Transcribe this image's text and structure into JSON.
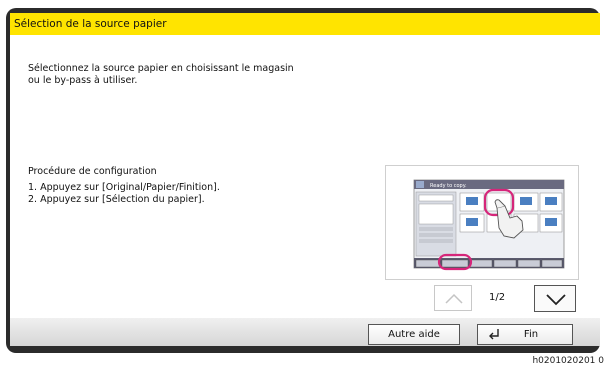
{
  "dialog": {
    "title": "Sélection de la source papier",
    "intro": "Sélectionnez la source papier en choisissant le magasin ou le by-pass à utiliser.",
    "procedure_title": "Procédure de configuration",
    "steps": [
      "1. Appuyez sur [Original/Papier/Finition].",
      "2. Appuyez sur [Sélection du papier]."
    ]
  },
  "pagination": {
    "indicator": "1/2"
  },
  "buttons": {
    "other_help": "Autre aide",
    "end": "Fin"
  },
  "illustration": {
    "screen_title": "Ready to copy.",
    "icons": [
      "touch-panel-screen",
      "highlight-circle",
      "pointing-hand-icon"
    ],
    "colors": {
      "highlight": "#d6267a",
      "panel": "#6a6a80"
    }
  },
  "caption": {
    "image_code": "h0201020201 0"
  }
}
